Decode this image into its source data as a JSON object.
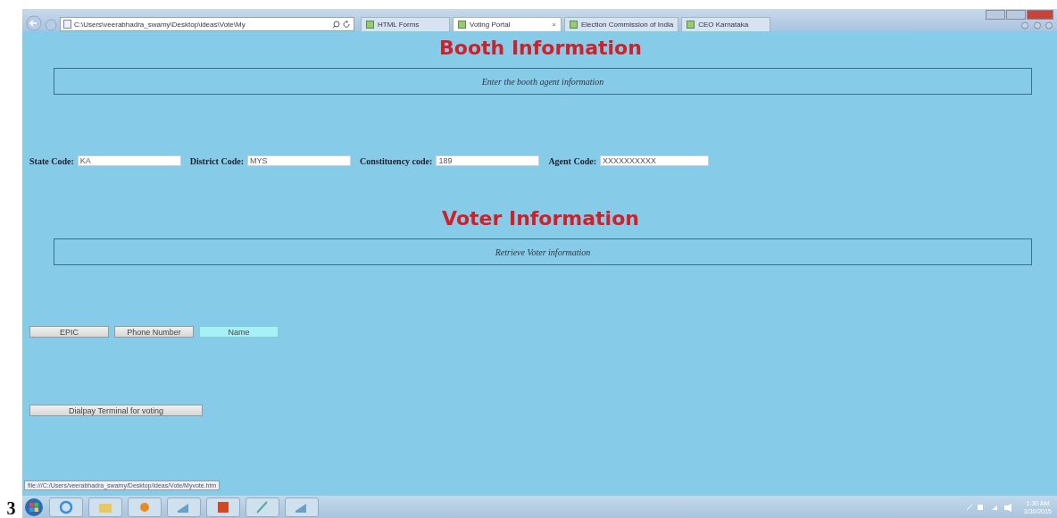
{
  "page_number": "3",
  "browser": {
    "address": "C:\\Users\\veerabhadra_swamy\\Desktop\\ideas\\Vote\\My",
    "close_glyph": "×",
    "tabs": [
      {
        "label": "HTML Forms",
        "selected": false
      },
      {
        "label": "Voting Portal",
        "selected": true
      },
      {
        "label": "Election Commission of India",
        "selected": false
      },
      {
        "label": "CEO Karnataka",
        "selected": false
      }
    ]
  },
  "sections": [
    {
      "heading": "Booth Information",
      "banner": "Enter the booth agent information",
      "fields": [
        {
          "label": "State Code:",
          "value": "KA"
        },
        {
          "label": "District Code:",
          "value": "MYS"
        },
        {
          "label": "Constituency code:",
          "value": "189"
        },
        {
          "label": "Agent Code:",
          "value": "XXXXXXXXXX"
        }
      ]
    },
    {
      "heading": "Voter Information",
      "banner": "Retrieve Voter information"
    }
  ],
  "search_buttons": [
    {
      "label": "EPIC",
      "selected": false
    },
    {
      "label": "Phone Number",
      "selected": false
    },
    {
      "label": "Name",
      "selected": true
    }
  ],
  "display_button": "Dialpay Terminal for voting",
  "status_url": "file:///C:/Users/veerabhadra_swamy/Desktop/ideas/Vote/Myvote.htm",
  "clock": {
    "time": "1:30 AM",
    "date": "3/30/2015"
  }
}
